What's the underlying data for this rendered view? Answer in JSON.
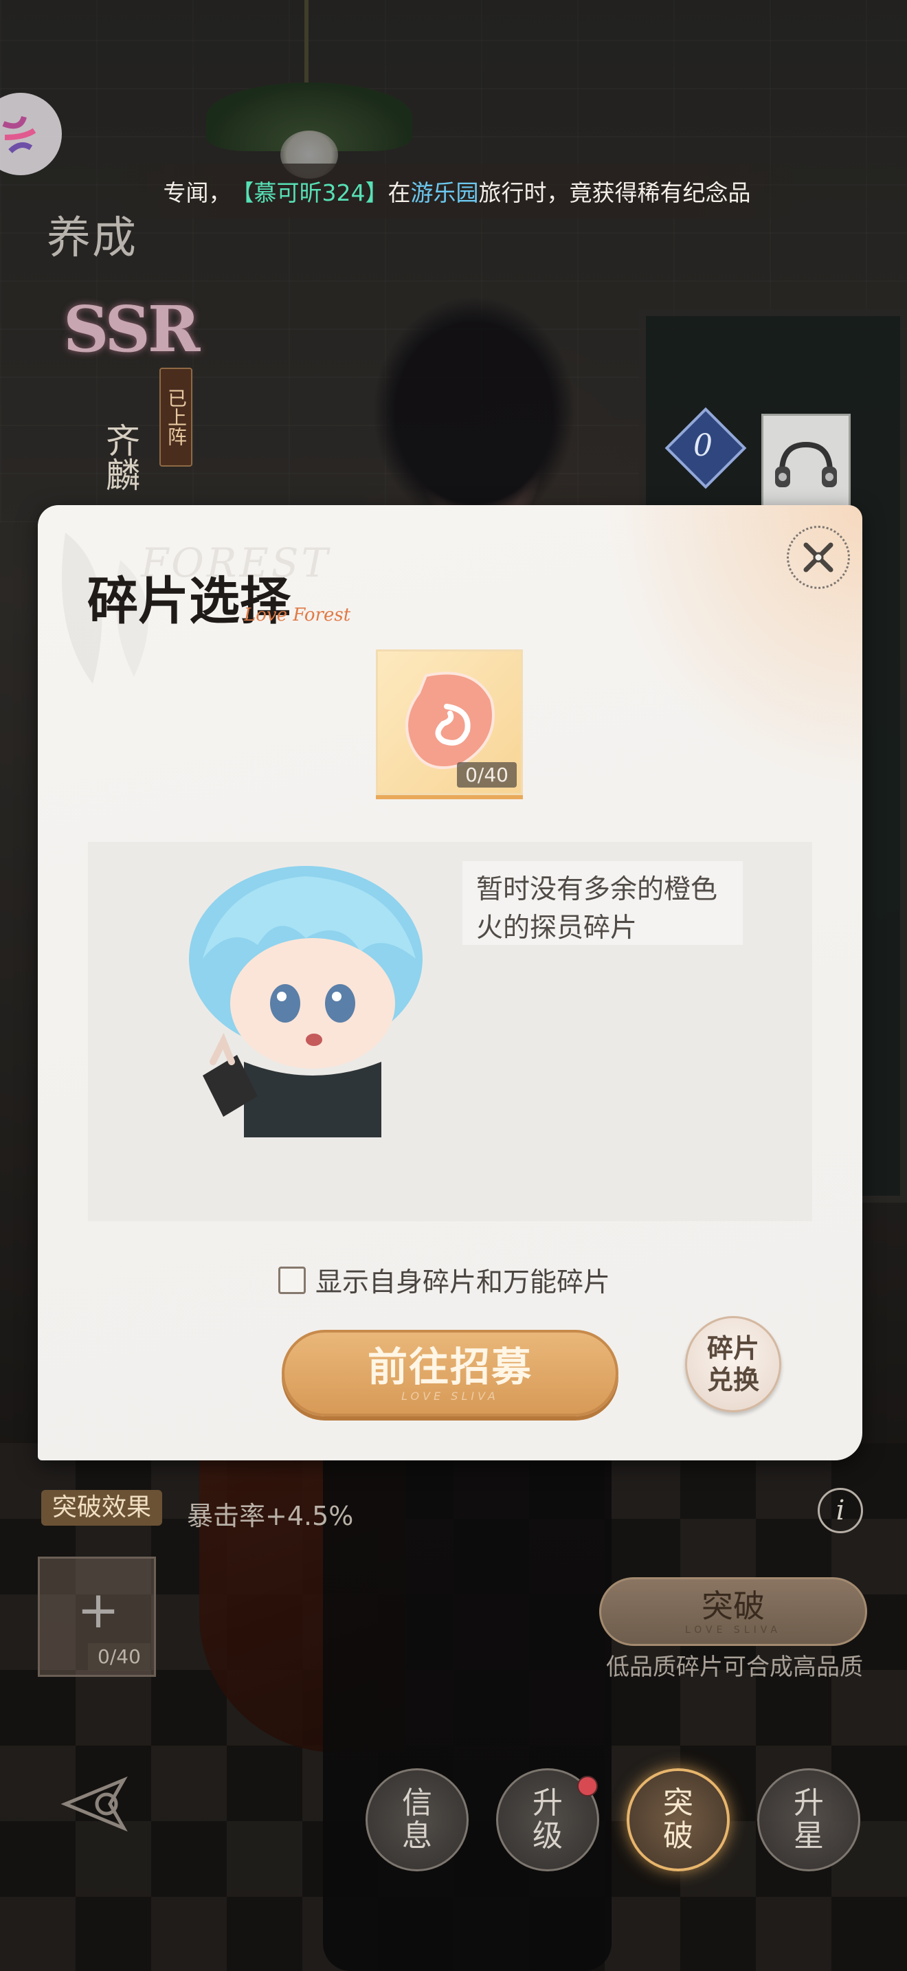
{
  "banner": {
    "prefix": "专闻，",
    "player": "【慕可昕324】",
    "mid": "在",
    "place": "游乐园",
    "suffix": "旅行时，竟获得稀有纪念品"
  },
  "page_title": "养成",
  "character": {
    "rarity": "SSR",
    "deployed_label": "已上阵",
    "name": "齐麟",
    "gem_label": "0"
  },
  "dialog": {
    "title": "碎片选择",
    "watermark": "FOREST",
    "script": "Love Forest",
    "fragment_count": "0/40",
    "empty_message": "暂时没有多余的橙色火的探员碎片",
    "checkbox_label": "显示自身碎片和万能碎片",
    "checkbox_checked": false,
    "recruit_button": "前往招募",
    "recruit_button_sub": "LOVE SLIVA",
    "exchange_button_line1": "碎片",
    "exchange_button_line2": "兑换"
  },
  "details": {
    "effect_badge": "突破效果",
    "effect_value": "暴击率+4.5%",
    "info_label": "i",
    "fragment_slot_count": "0/40",
    "breakthrough_button": "突破",
    "breakthrough_sub": "LOVE SLIVA",
    "hint": "低品质碎片可合成高品质"
  },
  "nav": {
    "info_1": "信",
    "info_2": "息",
    "levelup_1": "升",
    "levelup_2": "级",
    "breakthrough_1": "突",
    "breakthrough_2": "破",
    "star_1": "升",
    "star_2": "星",
    "levelup_has_notification": true
  },
  "colors": {
    "accent_orange": "#d89a57",
    "highlight_green": "#57e0b6",
    "highlight_blue": "#6cc8f0",
    "notification_red": "#d84a52"
  }
}
